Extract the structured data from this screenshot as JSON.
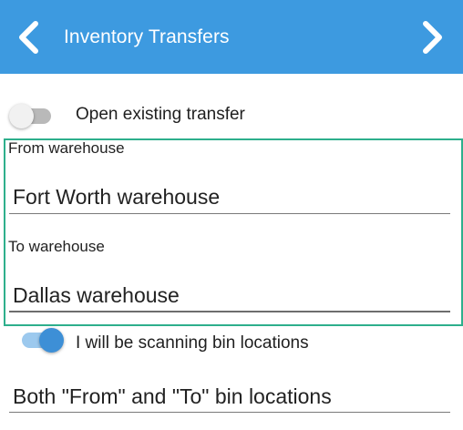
{
  "header": {
    "title": "Inventory Transfers",
    "back_icon": "chevron-left-icon",
    "forward_icon": "chevron-right-icon",
    "background_color": "#3d9ae0"
  },
  "open_existing": {
    "label": "Open existing transfer",
    "checked": false
  },
  "from_warehouse": {
    "label": "From warehouse",
    "value": "Fort Worth warehouse"
  },
  "to_warehouse": {
    "label": "To warehouse",
    "value": "Dallas warehouse"
  },
  "scanning_bins": {
    "label": "I will be scanning bin locations",
    "checked": true
  },
  "bin_mode": {
    "value": "Both \"From\" and \"To\" bin locations"
  },
  "colors": {
    "focus_border": "#2eaf8c",
    "toggle_on": "#3d8fd6"
  }
}
